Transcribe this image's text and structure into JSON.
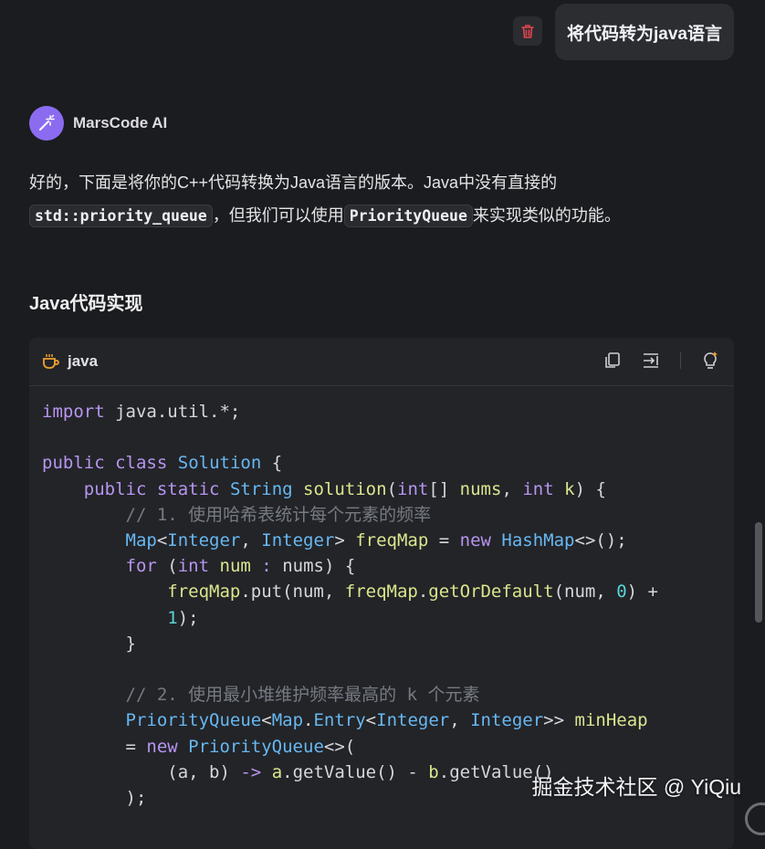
{
  "user_message": {
    "text": "将代码转为java语言"
  },
  "assistant": {
    "name": "MarsCode AI",
    "intro": {
      "part1": "好的，下面是将你的C++代码转换为Java语言的版本。Java中没有直接的",
      "code1": "std::priority_queue",
      "part2": "，但我们可以使用",
      "code2": "PriorityQueue",
      "part3": "来实现类似的功能。"
    },
    "heading": "Java代码实现"
  },
  "code_block": {
    "language": "java",
    "toolbar": [
      "copy-icon",
      "insert-icon",
      "magic-icon"
    ],
    "lines": [
      "import java.util.*;",
      "",
      "public class Solution {",
      "    public static String solution(int[] nums, int k) {",
      "        // 1. 使用哈希表统计每个元素的频率",
      "        Map<Integer, Integer> freqMap = new HashMap<>();",
      "        for (int num : nums) {",
      "            freqMap.put(num, freqMap.getOrDefault(num, 0) +",
      "            1);",
      "        }",
      "",
      "        // 2. 使用最小堆维护频率最高的 k 个元素",
      "        PriorityQueue<Map.Entry<Integer, Integer>> minHeap",
      "        = new PriorityQueue<>(",
      "            (a, b) -> a.getValue() - b.getValue()",
      "        );"
    ]
  },
  "watermark": "掘金技术社区 @ YiQiu",
  "colors": {
    "background": "#1b1c1f",
    "keyword": "#b795f0",
    "type": "#67b8f2",
    "function": "#dbe58d",
    "number": "#5ad4d8",
    "comment": "#767a82",
    "avatar": "#8b6cf0",
    "trash": "#e0454f"
  }
}
